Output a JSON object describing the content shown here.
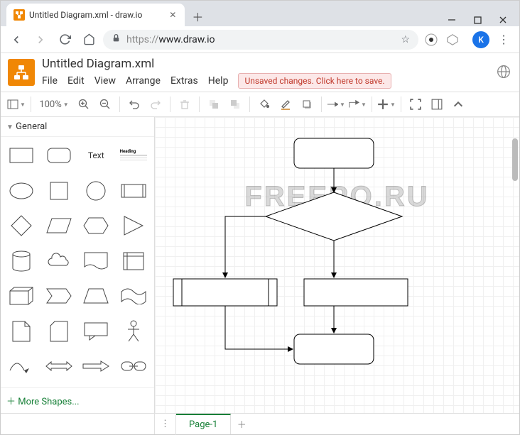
{
  "browser": {
    "tab_title": "Untitled Diagram.xml - draw.io",
    "url_display": "https://www.draw.io",
    "url_prefix": "https://",
    "url_host": "www.draw.io",
    "avatar_letter": "K"
  },
  "app": {
    "title": "Untitled Diagram.xml",
    "menu": {
      "file": "File",
      "edit": "Edit",
      "view": "View",
      "arrange": "Arrange",
      "extras": "Extras",
      "help": "Help"
    },
    "unsaved_msg": "Unsaved changes. Click here to save.",
    "zoom": "100%"
  },
  "sidebar": {
    "panel_title": "General",
    "text_label": "Text",
    "heading_label": "Heading",
    "more_shapes": "More Shapes..."
  },
  "watermark": "FREEPO.RU",
  "page": {
    "name": "Page-1"
  }
}
